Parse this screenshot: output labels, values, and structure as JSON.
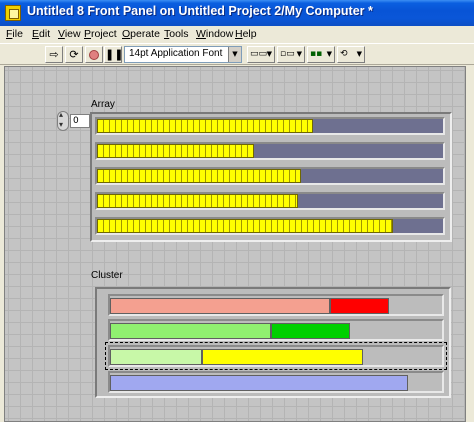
{
  "window": {
    "title": "Untitled 8 Front Panel on Untitled Project 2/My Computer *"
  },
  "menu": {
    "items": [
      "File",
      "Edit",
      "View",
      "Project",
      "Operate",
      "Tools",
      "Window",
      "Help"
    ]
  },
  "toolbar": {
    "font_select": "14pt Application Font",
    "icons": [
      "run-arrow-icon",
      "run-continuously-icon",
      "abort-icon",
      "pause-icon",
      "align-icon",
      "distribute-icon",
      "resize-icon",
      "reorder-icon"
    ]
  },
  "array": {
    "label": "Array",
    "index_value": "0",
    "slide_fills": [
      0.625,
      0.455,
      0.59,
      0.58,
      0.855
    ],
    "fill_color": "#ffff00",
    "track_color": "#6e7090"
  },
  "cluster": {
    "label": "Cluster",
    "slides": [
      {
        "segments": [
          {
            "fraction": 0.67,
            "color": "#f4a090"
          },
          {
            "fraction": 0.18,
            "color": "#ff0000"
          }
        ]
      },
      {
        "segments": [
          {
            "fraction": 0.49,
            "color": "#90f070"
          },
          {
            "fraction": 0.24,
            "color": "#00d000"
          }
        ]
      },
      {
        "segments": [
          {
            "fraction": 0.28,
            "color": "#c8f8a8"
          },
          {
            "fraction": 0.49,
            "color": "#ffff00"
          }
        ]
      },
      {
        "segments": [
          {
            "fraction": 0.91,
            "color": "#a0a8f0"
          }
        ]
      }
    ]
  }
}
